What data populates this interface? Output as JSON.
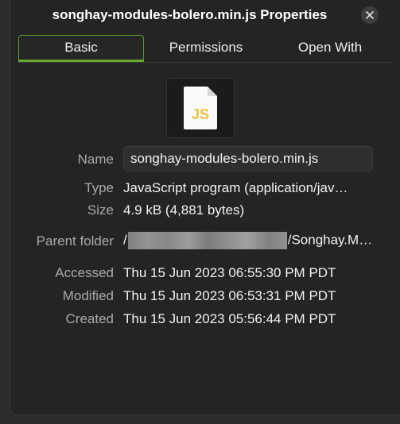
{
  "window": {
    "title": "songhay-modules-bolero.min.js Properties"
  },
  "icons": {
    "close": "close-icon",
    "file": "javascript-file-icon"
  },
  "file_icon": {
    "label": "JS",
    "accent_color": "#f0c23b"
  },
  "tabs": [
    {
      "label": "Basic",
      "active": true
    },
    {
      "label": "Permissions",
      "active": false
    },
    {
      "label": "Open With",
      "active": false
    }
  ],
  "colors": {
    "active_tab_accent": "#66a82e",
    "background": "#242424"
  },
  "properties": {
    "name_label": "Name",
    "name_value": "songhay-modules-bolero.min.js",
    "type_label": "Type",
    "type_value": "JavaScript program (application/jav…",
    "size_label": "Size",
    "size_value": "4.9 kB (4,881 bytes)",
    "parent_label": "Parent folder",
    "parent_prefix": "/",
    "parent_suffix": "/Songhay.M…",
    "accessed_label": "Accessed",
    "accessed_value": "Thu 15 Jun 2023 06:55:30 PM PDT",
    "modified_label": "Modified",
    "modified_value": "Thu 15 Jun 2023 06:53:31 PM PDT",
    "created_label": "Created",
    "created_value": "Thu 15 Jun 2023 05:56:44 PM PDT"
  }
}
